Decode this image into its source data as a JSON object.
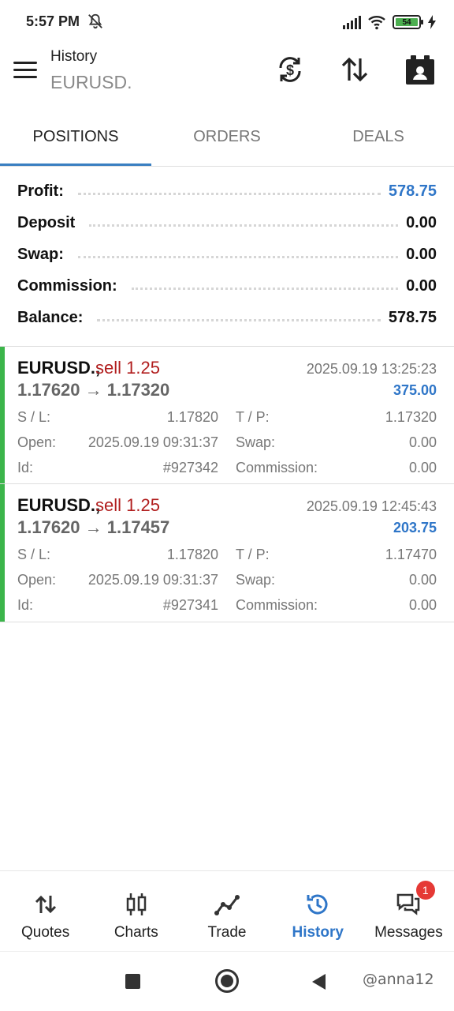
{
  "status_bar": {
    "time": "5:57 PM",
    "battery": "54"
  },
  "app_bar": {
    "title": "History",
    "subtitle": "EURUSD."
  },
  "tabs": [
    {
      "label": "POSITIONS",
      "active": true
    },
    {
      "label": "ORDERS",
      "active": false
    },
    {
      "label": "DEALS",
      "active": false
    }
  ],
  "summary": {
    "profit": {
      "label": "Profit:",
      "value": "578.75"
    },
    "deposit": {
      "label": "Deposit",
      "value": "0.00"
    },
    "swap": {
      "label": "Swap:",
      "value": "0.00"
    },
    "commission": {
      "label": "Commission:",
      "value": "0.00"
    },
    "balance": {
      "label": "Balance:",
      "value": "578.75"
    }
  },
  "trades": [
    {
      "symbol": "EURUSD.,",
      "side": "sell 1.25",
      "time": "2025.09.19 13:25:23",
      "prices": "1.17620 → 1.17320",
      "profit": "375.00",
      "sl_label": "S / L:",
      "sl": "1.17820",
      "tp_label": "T / P:",
      "tp": "1.17320",
      "open_label": "Open:",
      "open": "2025.09.19 09:31:37",
      "swap_label": "Swap:",
      "swap": "0.00",
      "id_label": "Id:",
      "id": "#927342",
      "commission_label": "Commission:",
      "commission": "0.00"
    },
    {
      "symbol": "EURUSD.,",
      "side": "sell 1.25",
      "time": "2025.09.19 12:45:43",
      "prices": "1.17620 → 1.17457",
      "profit": "203.75",
      "sl_label": "S / L:",
      "sl": "1.17820",
      "tp_label": "T / P:",
      "tp": "1.17470",
      "open_label": "Open:",
      "open": "2025.09.19 09:31:37",
      "swap_label": "Swap:",
      "swap": "0.00",
      "id_label": "Id:",
      "id": "#927341",
      "commission_label": "Commission:",
      "commission": "0.00"
    }
  ],
  "bottom_nav": [
    {
      "label": "Quotes",
      "icon": "quotes-arrows-icon",
      "active": false
    },
    {
      "label": "Charts",
      "icon": "candlestick-icon",
      "active": false
    },
    {
      "label": "Trade",
      "icon": "trend-line-icon",
      "active": false
    },
    {
      "label": "History",
      "icon": "history-clock-icon",
      "active": true
    },
    {
      "label": "Messages",
      "icon": "chat-bubbles-icon",
      "active": false,
      "badge": "1"
    }
  ],
  "watermark": "@anna12",
  "colors": {
    "accent_blue": "#2f76c8",
    "sell_red": "#b11e1e",
    "position_green": "#3bb54a",
    "badge_red": "#e53935"
  }
}
